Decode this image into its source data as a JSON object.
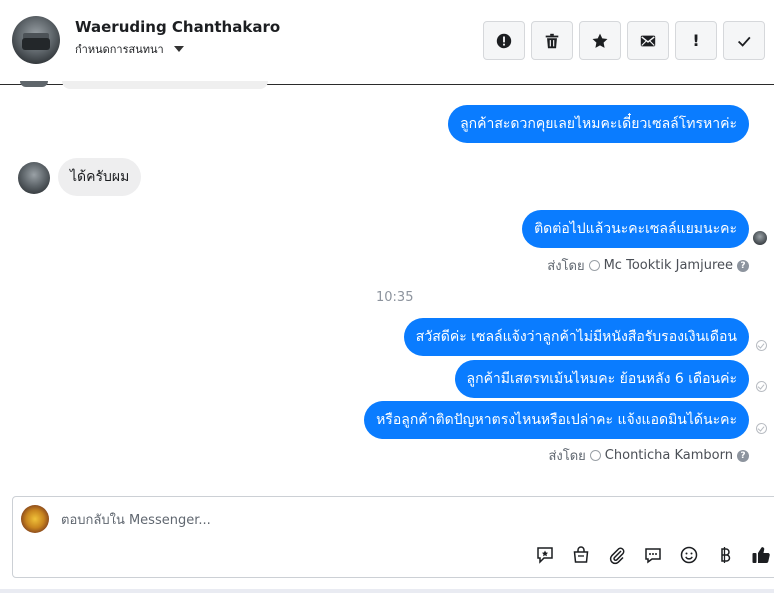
{
  "header": {
    "contact_name": "Waeruding Chanthakaro",
    "subtitle": "กำหนดการสนทนา",
    "buttons": [
      {
        "name": "report-button",
        "icon": "alert-circle-icon"
      },
      {
        "name": "delete-button",
        "icon": "trash-icon"
      },
      {
        "name": "star-button",
        "icon": "star-icon"
      },
      {
        "name": "mark-unread-button",
        "icon": "envelope-icon"
      },
      {
        "name": "follow-up-button",
        "icon": "exclamation-icon",
        "label": "!"
      },
      {
        "name": "mark-done-button",
        "icon": "check-icon"
      }
    ]
  },
  "messages": {
    "m1": "ลูกค้าสะดวกคุยเลยไหมคะเดี๋ยวเซลล์โทรหาค่ะ",
    "m2": "ได้ครับผม",
    "m3": "ติดต่อไปแล้วนะคะเซลล์แยมนะคะ",
    "sent_by_1": {
      "prefix": "ส่งโดย",
      "name": "Mc Tooktik Jamjuree",
      "help": "?"
    },
    "time": "10:35",
    "m4": "สวัสดีค่ะ เซลล์แจ้งว่าลูกค้าไม่มีหนังสือรับรองเงินเดือน",
    "m5": "ลูกค้ามีเสตรทเม้นไหมคะ ย้อนหลัง 6 เดือนค่ะ",
    "m6": "หรือลูกค้าติดปัญหาตรงไหนหรือเปล่าคะ แจ้งแอดมินได้นะคะ",
    "sent_by_2": {
      "prefix": "ส่งโดย",
      "name": "Chonticha Kamborn",
      "help": "?"
    }
  },
  "composer": {
    "placeholder": "ตอบกลับใน Messenger...",
    "icons": [
      "saved-reply-icon",
      "shop-bag-icon",
      "attachment-icon",
      "chat-bubble-icon",
      "emoji-icon",
      "baht-payment-icon",
      "thumbs-up-icon"
    ]
  },
  "colors": {
    "outgoing_bubble": "#0a7cff",
    "incoming_bubble": "#eeeeef"
  }
}
